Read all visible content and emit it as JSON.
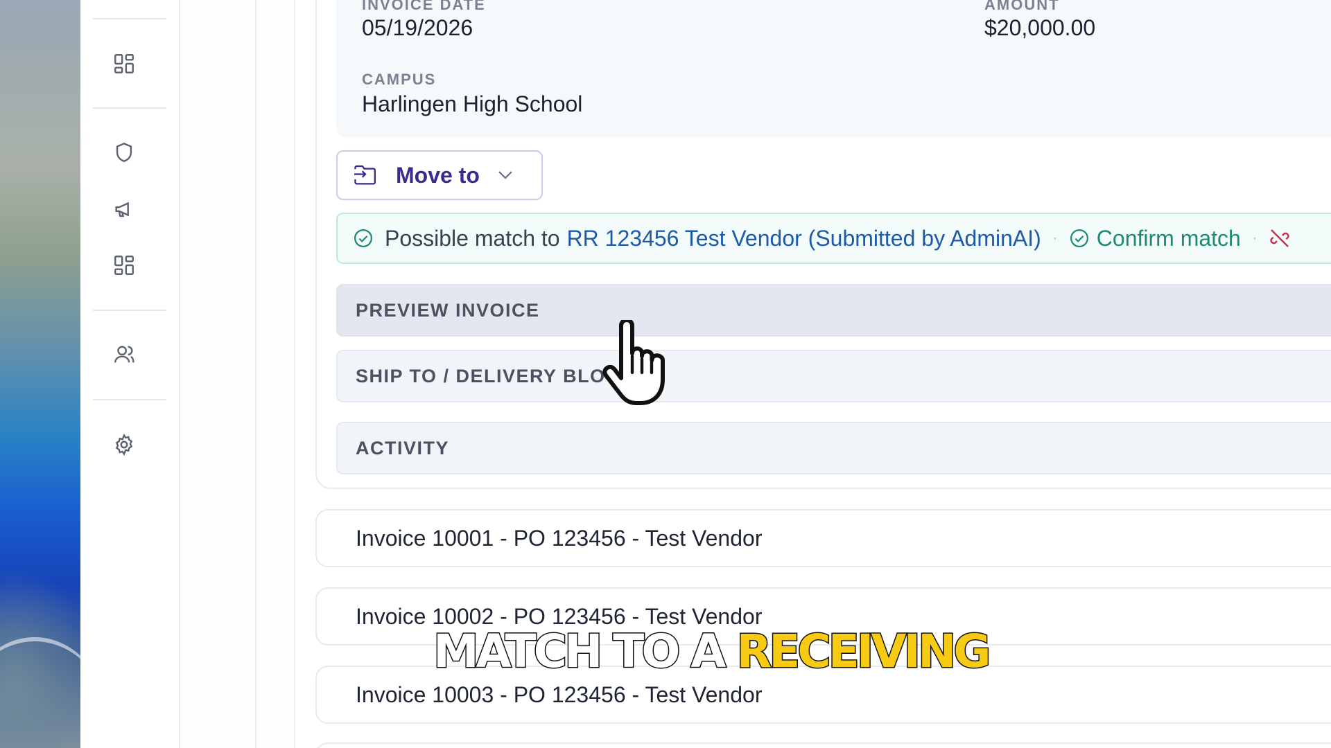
{
  "rail": {
    "icons": [
      "dashboard-grid-icon",
      "shield-icon",
      "megaphone-icon",
      "apps-grid-icon",
      "users-icon",
      "settings-gear-icon"
    ]
  },
  "invoice": {
    "date_label": "INVOICE DATE",
    "date_value": "05/19/2026",
    "amount_label": "AMOUNT",
    "amount_value": "$20,000.00",
    "campus_label": "CAMPUS",
    "campus_value": "Harlingen High School"
  },
  "move_button": {
    "label": "Move to",
    "icon": "folder-move-icon"
  },
  "match_bar": {
    "prefix": "Possible match to",
    "link": "RR 123456 Test Vendor (Submitted by AdminAI)",
    "separator": "·",
    "confirm": "Confirm match",
    "icon": "check-circle-icon",
    "unlink_icon": "unlink-icon"
  },
  "sections": [
    {
      "label": "PREVIEW INVOICE"
    },
    {
      "label": "SHIP TO / DELIVERY BLOCK"
    },
    {
      "label": "ACTIVITY"
    }
  ],
  "invoices": [
    {
      "title": "Invoice 10001 - PO 123456 - Test Vendor"
    },
    {
      "title": "Invoice 10002 - PO 123456 - Test Vendor"
    },
    {
      "title": "Invoice 10003 - PO 123456 - Test Vendor"
    }
  ],
  "caption": {
    "white": "MATCH TO A ",
    "yellow": "RECEIVING"
  },
  "colors": {
    "accent": "#3b2a8f",
    "link": "#1d5aa8",
    "confirm": "#1f8a6e",
    "caption_yellow": "#f7cb14"
  }
}
